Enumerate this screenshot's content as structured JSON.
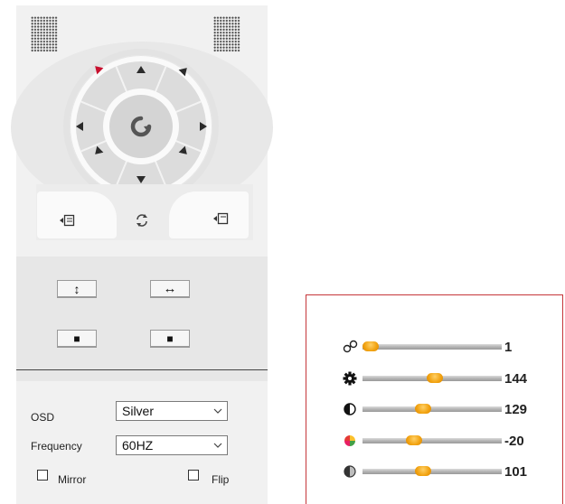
{
  "ptz": {
    "tool_buttons": {
      "vertical_flip": "↕",
      "horizontal_flip": "↔",
      "stop_left": "■",
      "stop_right": "■"
    },
    "icons": {
      "center": "refresh-icon",
      "preset_left": "preset-load-icon",
      "preset_right": "preset-save-icon",
      "refresh": "sync-icon"
    },
    "accent_color": "#c8102e"
  },
  "settings": {
    "osd_label": "OSD",
    "osd_value": "Silver",
    "frequency_label": "Frequency",
    "frequency_value": "60HZ",
    "mirror_label": "Mirror",
    "mirror_checked": false,
    "flip_label": "Flip",
    "flip_checked": false
  },
  "image_adjust": {
    "border_color": "#c5363a",
    "sliders": [
      {
        "name": "zoom",
        "icon": "zoom-icon",
        "value_text": "1",
        "position": 0.0
      },
      {
        "name": "sharpness",
        "icon": "gear-icon",
        "value_text": "144",
        "position": 0.52
      },
      {
        "name": "contrast",
        "icon": "contrast-icon",
        "value_text": "129",
        "position": 0.43
      },
      {
        "name": "saturation",
        "icon": "color-icon",
        "value_text": "-20",
        "position": 0.35
      },
      {
        "name": "brightness",
        "icon": "brightness-icon",
        "value_text": "101",
        "position": 0.43
      }
    ]
  }
}
